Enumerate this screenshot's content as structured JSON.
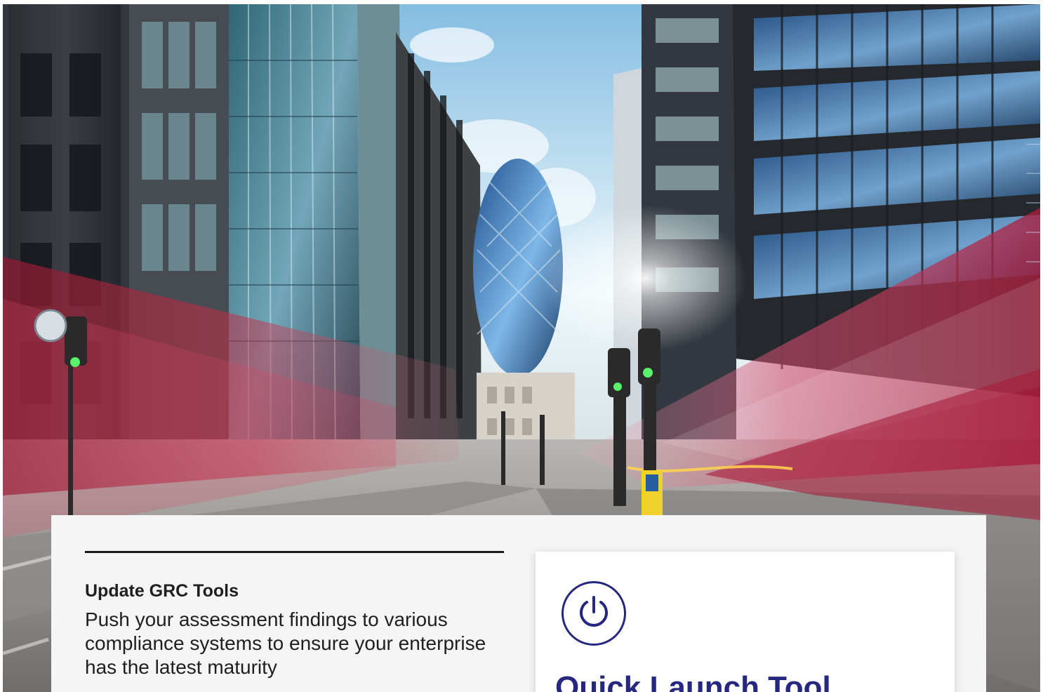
{
  "hero": {
    "image_subject": "city-street-skyscrapers"
  },
  "content": {
    "grc_tools": {
      "title": "Update GRC Tools",
      "body": "Push your assessment findings to various compliance systems to ensure your enterprise has the latest maturity"
    },
    "quick_launch": {
      "icon": "power-icon",
      "title": "Quick Launch Tool"
    }
  },
  "colors": {
    "panel_background": "#f5f5f5",
    "card_background": "#ffffff",
    "brand_blue": "#26277e",
    "body_text": "#1f1f1f"
  }
}
